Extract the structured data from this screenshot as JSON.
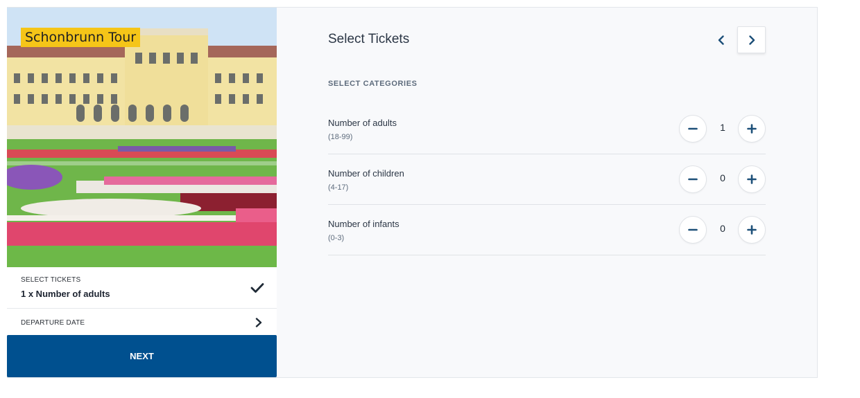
{
  "tour": {
    "title": "Schonbrunn Tour"
  },
  "summary": {
    "tickets_label": "SELECT TICKETS",
    "tickets_value": "1 x Number of adults",
    "date_label": "DEPARTURE DATE"
  },
  "next_button": {
    "label": "NEXT"
  },
  "panel": {
    "title": "Select Tickets",
    "section_label": "SELECT CATEGORIES",
    "categories": [
      {
        "name": "Number of adults",
        "range": "(18-99)",
        "quantity": "1"
      },
      {
        "name": "Number of children",
        "range": "(4-17)",
        "quantity": "0"
      },
      {
        "name": "Number of infants",
        "range": "(0-3)",
        "quantity": "0"
      }
    ]
  },
  "icons": {
    "check": "check-icon",
    "chevron_right": "chevron-right-icon",
    "chevron_left": "chevron-left-icon",
    "minus": "minus-icon",
    "plus": "plus-icon"
  },
  "colors": {
    "accent": "#00508f",
    "badge": "#f5c518",
    "stepper_icon": "#1c4f78"
  }
}
